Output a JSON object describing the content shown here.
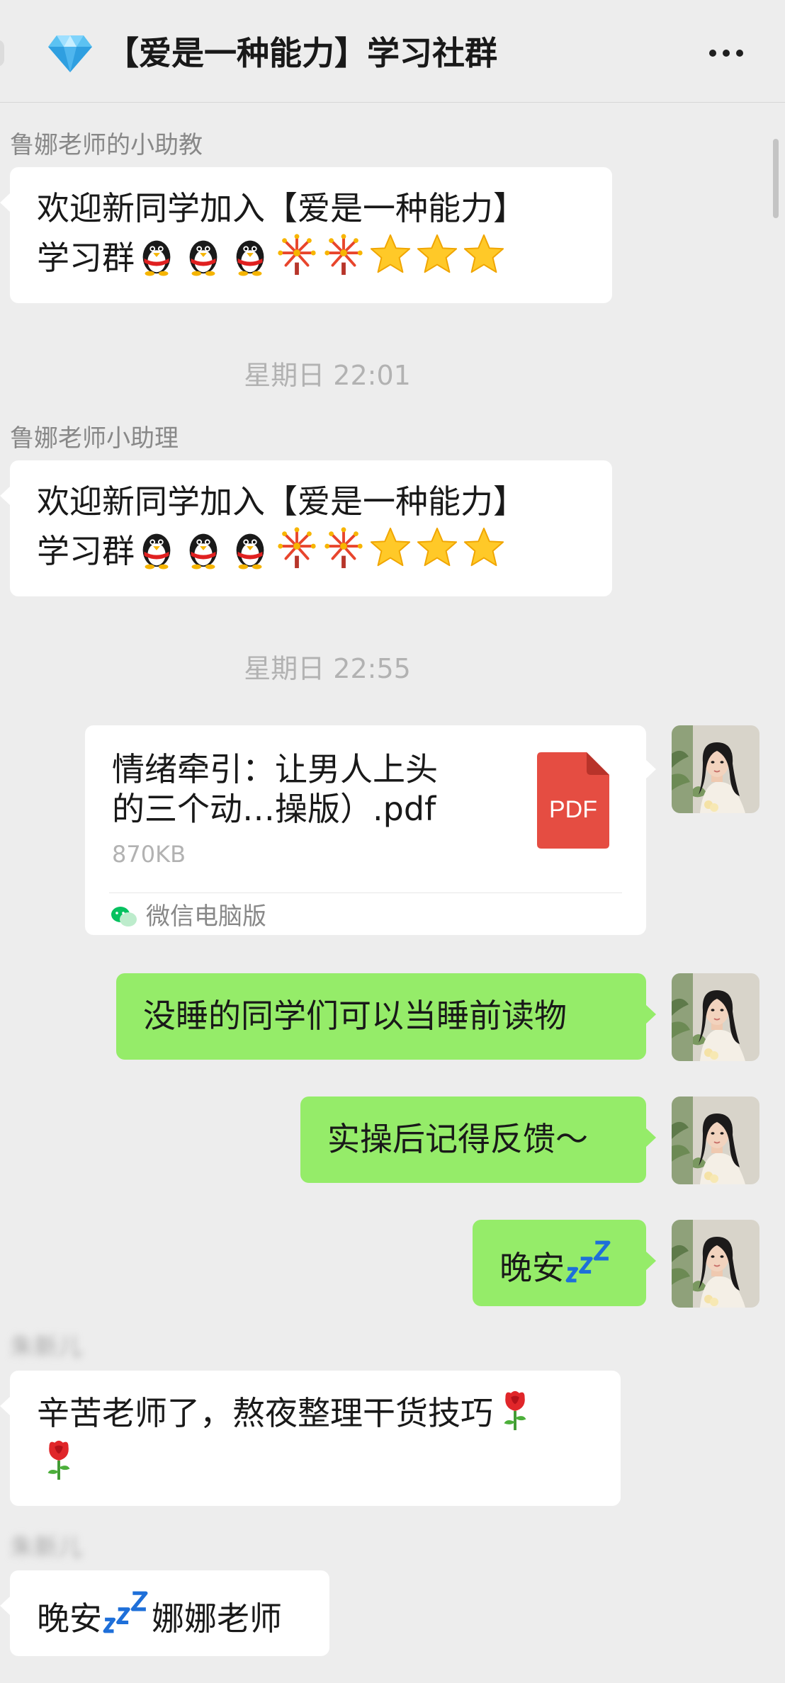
{
  "header": {
    "title": "【爱是一种能力】学习社群",
    "title_icon": "diamond-icon",
    "more_icon": "more-icon"
  },
  "messages": [
    {
      "sender": "鲁娜老师的小助教",
      "lines": [
        "欢迎新同学加入【爱是一种能力】",
        "学习群"
      ],
      "emoji": [
        "penguin-icon",
        "penguin-icon",
        "penguin-icon",
        "fireworks-icon",
        "fireworks-icon",
        "star-icon",
        "star-icon",
        "star-icon"
      ]
    },
    {
      "timestamp": "星期日 22:01"
    },
    {
      "sender": "鲁娜老师小助理",
      "lines": [
        "欢迎新同学加入【爱是一种能力】",
        "学习群"
      ],
      "emoji": [
        "penguin-icon",
        "penguin-icon",
        "penguin-icon",
        "fireworks-icon",
        "fireworks-icon",
        "star-icon",
        "star-icon",
        "star-icon"
      ]
    },
    {
      "timestamp": "星期日 22:55"
    },
    {
      "file": {
        "name_line1": "情绪牵引：让男人上头",
        "name_line2": "的三个动…操版）.pdf",
        "size": "870KB",
        "icon_label": "PDF",
        "source": "微信电脑版"
      }
    },
    {
      "self_text": "没睡的同学们可以当睡前读物"
    },
    {
      "self_text": "实操后记得反馈～"
    },
    {
      "self_text": "晚安",
      "self_emoji": "zzz-icon"
    },
    {
      "sender": "朱新儿",
      "sender_blurred": true,
      "lines": [
        "辛苦老师了，熬夜整理干货技巧"
      ],
      "emoji": [
        "rose-icon",
        "rose-icon"
      ]
    },
    {
      "sender": "朱新儿",
      "sender_blurred": true,
      "text_before": "晚安",
      "text_after": "娜娜老师",
      "emoji": [
        "zzz-icon"
      ]
    }
  ],
  "colors": {
    "background": "#ededed",
    "self_bubble": "#95ec69",
    "other_bubble": "#ffffff",
    "pdf": "#e54d42"
  }
}
